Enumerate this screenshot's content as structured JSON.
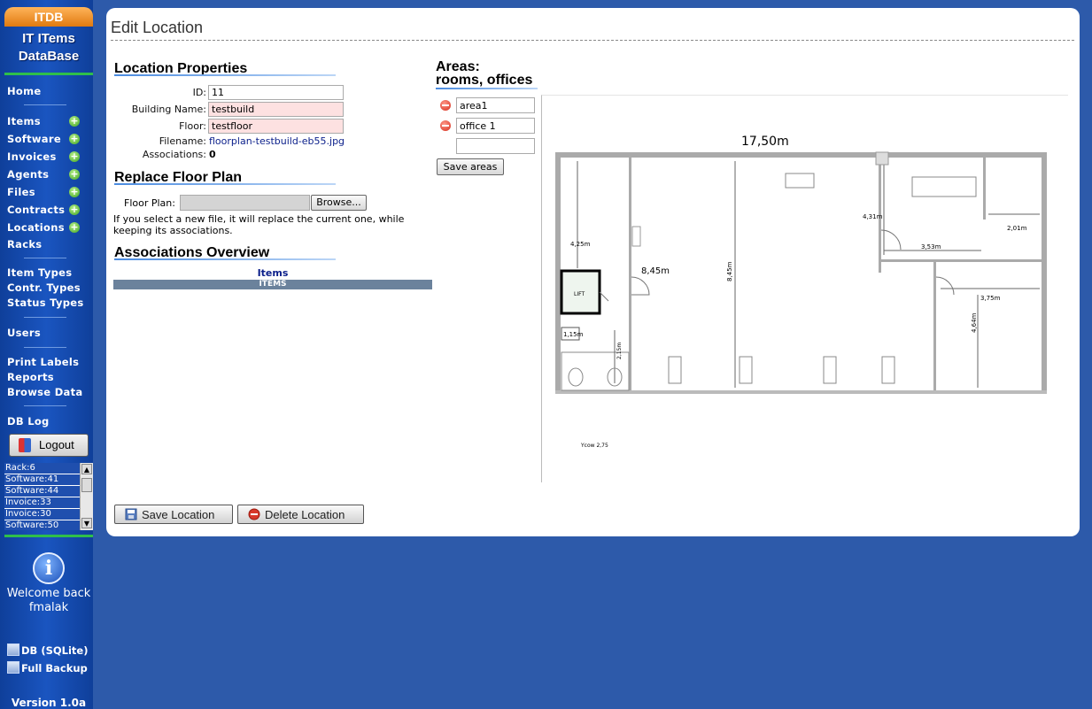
{
  "app": {
    "brand": "ITDB",
    "title": "IT ITems DataBase"
  },
  "sidebar": {
    "home": "Home",
    "items": [
      {
        "label": "Items",
        "add": "+"
      },
      {
        "label": "Software",
        "add": "+"
      },
      {
        "label": "Invoices",
        "add": "+"
      },
      {
        "label": "Agents",
        "add": "+"
      },
      {
        "label": "Files",
        "add": "+"
      },
      {
        "label": "Contracts",
        "add": "+"
      },
      {
        "label": "Locations",
        "add": "+"
      }
    ],
    "racks": "Racks",
    "item_types": "Item Types",
    "contr_types": "Contr. Types",
    "status_types": "Status Types",
    "users": "Users",
    "print_labels": "Print Labels",
    "reports": "Reports",
    "browse_data": "Browse Data",
    "db_log": "DB Log",
    "logout": "Logout",
    "history": [
      "Rack:6",
      "Software:41",
      "Software:44",
      "Invoice:33",
      "Invoice:30",
      "Software:50"
    ],
    "welcome": "Welcome back fmalak",
    "db": "DB (SQLite)",
    "backup": "Full Backup",
    "version": "Version 1.0a"
  },
  "page": {
    "title": "Edit Location",
    "props": {
      "heading": "Location Properties",
      "id_label": "ID:",
      "id_value": "11",
      "building_label": "Building Name:",
      "building_value": "testbuild",
      "floor_label": "Floor:",
      "floor_value": "testfloor",
      "filename_label": "Filename:",
      "filename_value": "floorplan-testbuild-eb55.jpg",
      "assoc_label": "Associations:",
      "assoc_value": "0"
    },
    "replace": {
      "heading": "Replace Floor Plan",
      "label": "Floor Plan:",
      "browse": "Browse...",
      "note": "If you select a new file, it will replace the current one, while keeping its associations."
    },
    "assoc": {
      "heading": "Associations Overview",
      "items_title": "Items",
      "items_bar": "ITEMS"
    },
    "areas": {
      "heading_line1": "Areas:",
      "heading_line2": "rooms, offices",
      "values": [
        "area1",
        "office 1"
      ],
      "new_value": "",
      "save": "Save areas"
    },
    "plan": {
      "width": "17,50m",
      "d1": "8,45m",
      "d2": "8,45m",
      "d3": "4,25m",
      "d4": "4,31m",
      "d5": "3,53m",
      "d6": "2,01m",
      "d7": "3,75m",
      "d8": "4,64m",
      "d9": "1,15m",
      "d10": "2,15m",
      "lift": "LIFT",
      "note": "Ycow 2,75"
    },
    "buttons": {
      "save": "Save Location",
      "delete": "Delete Location"
    }
  }
}
